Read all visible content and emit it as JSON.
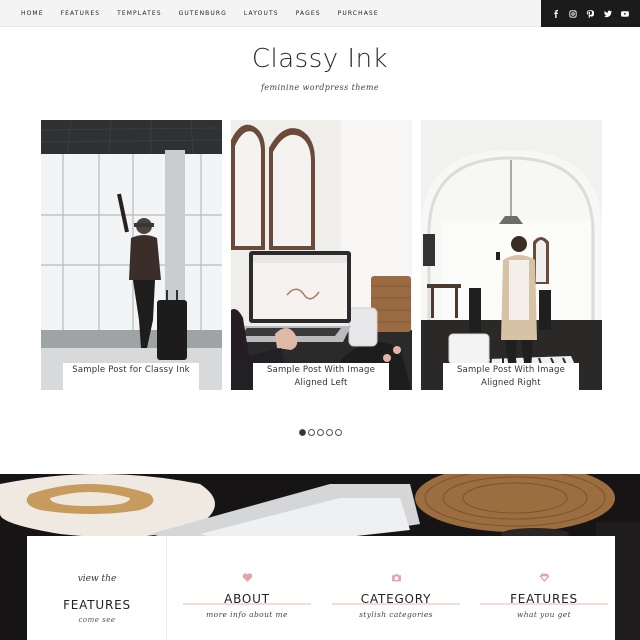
{
  "nav": {
    "items": [
      "HOME",
      "FEATURES",
      "TEMPLATES",
      "GUTENBURG",
      "LAYOUTS",
      "PAGES",
      "PURCHASE"
    ]
  },
  "social": [
    "facebook-icon",
    "instagram-icon",
    "pinterest-icon",
    "twitter-icon",
    "youtube-icon"
  ],
  "header": {
    "title": "Classy Ink",
    "tagline": "feminine wordpress theme"
  },
  "slider": {
    "slides": [
      {
        "caption": "Sample Post for Classy Ink"
      },
      {
        "caption": "Sample Post With Image Aligned Left"
      },
      {
        "caption": "Sample Post With Image Aligned Right"
      }
    ],
    "dot_count": 5,
    "active_dot": 1
  },
  "features": {
    "script": "view the",
    "title": "FEATURES",
    "subtitle": "come see",
    "cards": [
      {
        "icon": "heart-icon",
        "title": "ABOUT",
        "subtitle": "more info about me"
      },
      {
        "icon": "camera-icon",
        "title": "CATEGORY",
        "subtitle": "stylish categories"
      },
      {
        "icon": "diamond-icon",
        "title": "FEATURES",
        "subtitle": "what you get"
      }
    ]
  },
  "colors": {
    "accent": "#e3a3a8",
    "dark": "#1b1b1b",
    "underline": "#f1ddd5"
  }
}
